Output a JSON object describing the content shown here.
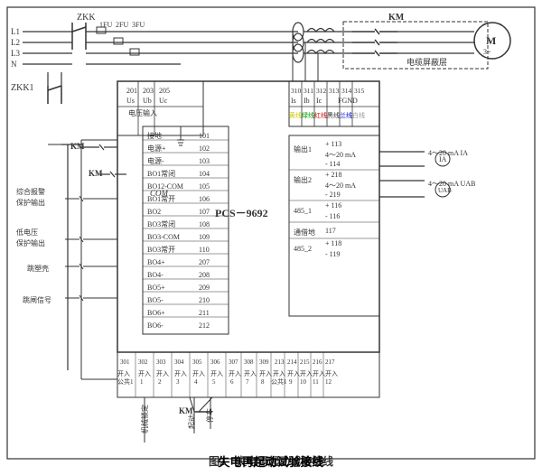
{
  "title": "失电再起动试验接线",
  "figure_number": "图2",
  "device": "PCS-9692",
  "labels": {
    "ZKK": "ZKK",
    "ZKK1": "ZKK1",
    "KM": "KM",
    "M": "M",
    "cable_shield": "电缆屏蔽层",
    "voltage_input": "电压输入",
    "fuses": [
      "1FU",
      "2FU",
      "3FU"
    ],
    "L_labels": [
      "L1",
      "L2",
      "L3",
      "N"
    ],
    "terminal_left": [
      "201",
      "203",
      "205"
    ],
    "terminal_bottom": [
      "301",
      "302",
      "303",
      "304",
      "305",
      "306",
      "307",
      "308",
      "309",
      "213",
      "214",
      "215",
      "216",
      "217"
    ],
    "terminal_right": [
      "310",
      "311",
      "312",
      "313",
      "314",
      "315"
    ],
    "right_labels": [
      "黄线",
      "绿线",
      "红线",
      "黑线",
      "兰线",
      "白线"
    ],
    "right_current": [
      "Is",
      "Ib",
      "Ic",
      "FGND"
    ],
    "outputs": [
      "输出1",
      "输出2",
      "485_1",
      "通借地",
      "485_2"
    ],
    "output_terminals": [
      "+113",
      "-114",
      "+218",
      "-219",
      "+116",
      "-116",
      "117",
      "+118",
      "-119"
    ],
    "output_ma": [
      "4～20 mA",
      "4～20 mA"
    ],
    "relay_labels": [
      "电源+",
      "电源-",
      "BO1常闭",
      "BO12-COM",
      "BO1常开",
      "BO2",
      "BO3常闭",
      "BO3-COM",
      "BO3常开",
      "BO4+",
      "BO4-",
      "BO5+",
      "BO5-",
      "BO6+",
      "BO6-"
    ],
    "relay_nums": [
      "101",
      "102",
      "103",
      "104",
      "105",
      "106",
      "107",
      "108",
      "109",
      "110",
      "207",
      "208",
      "209",
      "210",
      "211",
      "212"
    ],
    "ground": "接地",
    "alarm": "综合报警\n保护输出",
    "low_voltage": "低电压\n保护输出",
    "trip_shell": "跳塑壳",
    "trip_signal": "跳闸信号",
    "bottom_labels": [
      "开入\n公共1",
      "开入\n1",
      "开入\n2",
      "开入\n3",
      "开入\n4",
      "开入\n5",
      "开入\n6",
      "开入\n7",
      "开入\n8",
      "开入\n公共1",
      "开入\n9",
      "开入\n10",
      "开入\n11",
      "开入\n12"
    ],
    "bottom_text": [
      "机械锁定",
      "起动",
      "停车"
    ],
    "IA_label": "4～20 mA IA",
    "UAB_label": "4～20 mA UAB"
  }
}
